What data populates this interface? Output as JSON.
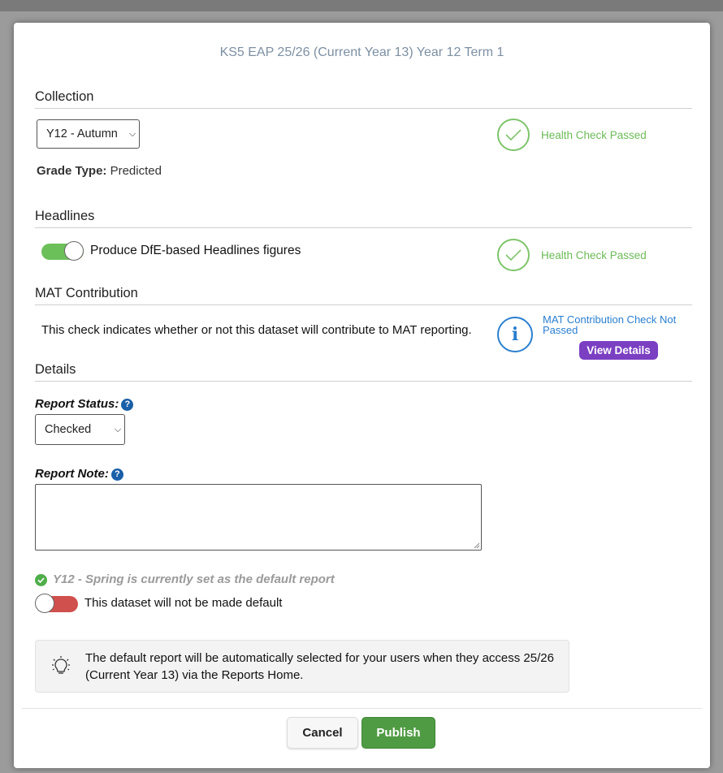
{
  "modal": {
    "title": "KS5 EAP 25/26 (Current Year 13) Year 12 Term 1"
  },
  "collection": {
    "heading": "Collection",
    "select_value": "Y12 - Autumn",
    "grade_type_label": "Grade Type:",
    "grade_type_value": "Predicted",
    "health_text": "Health Check Passed"
  },
  "headlines": {
    "heading": "Headlines",
    "toggle_label": "Produce DfE-based Headlines figures",
    "toggle_on": true,
    "health_text": "Health Check Passed"
  },
  "mat": {
    "heading": "MAT Contribution",
    "description": "This check indicates whether or not this dataset will contribute to MAT reporting.",
    "status_text": "MAT Contribution Check Not Passed",
    "view_details_label": "View Details"
  },
  "details": {
    "heading": "Details",
    "report_status_label": "Report Status:",
    "report_status_value": "Checked",
    "report_note_label": "Report Note:",
    "report_note_value": "",
    "default_notice": "Y12 - Spring is currently set as the default report",
    "default_toggle_label": "This dataset will not be made default",
    "default_toggle_on": false,
    "info_text": "The default report will be automatically selected for your users when they access 25/26 (Current Year 13) via the Reports Home.",
    "help_icon_glyph": "?"
  },
  "footer": {
    "cancel_label": "Cancel",
    "publish_label": "Publish"
  },
  "colors": {
    "success": "#6dbb58",
    "info": "#2a7fd0",
    "purple": "#7b3fc2",
    "toggle_on": "#6cc05a",
    "toggle_off": "#d0504d",
    "publish": "#4f9b43"
  },
  "icons": {
    "health": "check-circle-icon",
    "mat": "info-circle-icon",
    "default": "check-badge-icon",
    "info_box": "lightbulb-icon",
    "help": "question-circle-icon"
  }
}
